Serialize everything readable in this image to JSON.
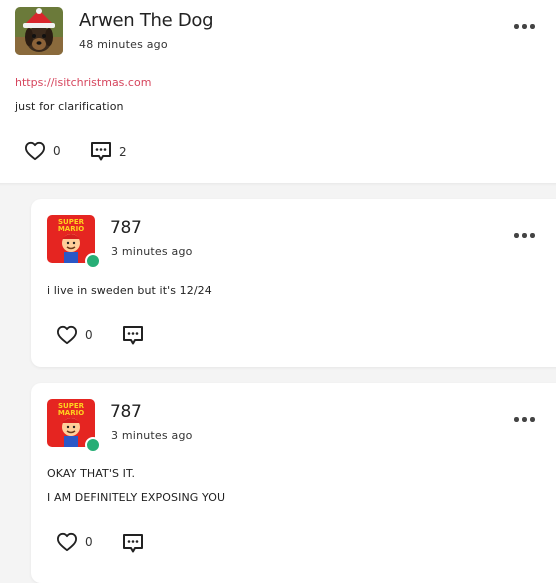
{
  "colors": {
    "accent_link": "#d6455d",
    "online": "#27ae76",
    "background": "#f4f4f4",
    "card": "#ffffff"
  },
  "main_post": {
    "author": "Arwen The Dog",
    "time": "48 minutes ago",
    "link": "https://isitchristmas.com",
    "text": "just for clarification",
    "likes": "0",
    "comments": "2",
    "avatar_icon": "dog-santa-hat-avatar",
    "menu_icon": "more-options-icon"
  },
  "replies": [
    {
      "author": "787",
      "time": "3 minutes ago",
      "lines": [
        "i live in sweden but it's 12/24"
      ],
      "likes": "0",
      "avatar_icon": "super-mario-avatar"
    },
    {
      "author": "787",
      "time": "3 minutes ago",
      "lines": [
        "OKAY THAT'S IT.",
        "I AM DEFINITELY EXPOSING YOU"
      ],
      "likes": "0",
      "avatar_icon": "super-mario-avatar"
    }
  ]
}
